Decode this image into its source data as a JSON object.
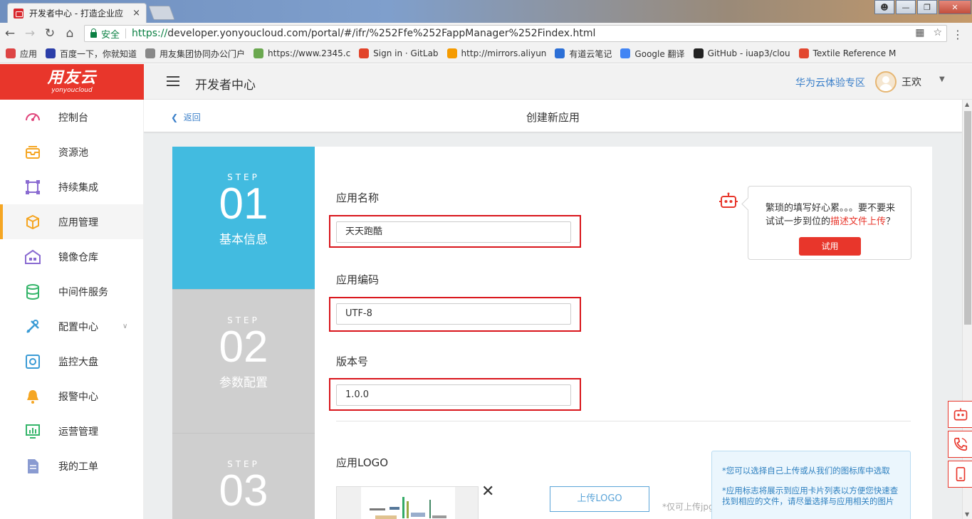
{
  "browser": {
    "tab_title": "开发者中心 - 打造企业应",
    "tab_close": "×",
    "secure_label": "安全",
    "url_scheme": "https://",
    "url_rest": "developer.yonyoucloud.com/portal/#/ifr/%252Ffe%252FappManager%252Findex.html",
    "bookmarks": [
      {
        "label": "应用",
        "color": "#d44"
      },
      {
        "label": "百度一下，你就知道",
        "color": "#2b3ea8"
      },
      {
        "label": "用友集团协同办公门户",
        "color": "#888"
      },
      {
        "label": "https://www.2345.c",
        "color": "#6aa84f"
      },
      {
        "label": "Sign in · GitLab",
        "color": "#e24329"
      },
      {
        "label": "http://mirrors.aliyun",
        "color": "#f59b00"
      },
      {
        "label": "有道云笔记",
        "color": "#2c6fd6"
      },
      {
        "label": "Google 翻译",
        "color": "#4285f4"
      },
      {
        "label": "GitHub - iuap3/clou",
        "color": "#222"
      },
      {
        "label": "Textile Reference M",
        "color": "#e2472f"
      }
    ]
  },
  "brand": {
    "cn": "用友云",
    "en": "yonyoucloud",
    "color": "#e8362b"
  },
  "header": {
    "title": "开发者中心",
    "link": "华为云体验专区",
    "username": "王欢"
  },
  "sidebar": {
    "items": [
      {
        "label": "控制台",
        "icon": "dashboard-icon",
        "color": "#e0457b"
      },
      {
        "label": "资源池",
        "icon": "resource-pool-icon",
        "color": "#f5a623"
      },
      {
        "label": "持续集成",
        "icon": "integration-icon",
        "color": "#8a6bd1"
      },
      {
        "label": "应用管理",
        "icon": "cube-icon",
        "color": "#f5a623"
      },
      {
        "label": "镜像仓库",
        "icon": "warehouse-icon",
        "color": "#8a6bd1"
      },
      {
        "label": "中间件服务",
        "icon": "database-icon",
        "color": "#35b56a"
      },
      {
        "label": "配置中心",
        "icon": "tools-icon",
        "color": "#3a9bd5"
      },
      {
        "label": "监控大盘",
        "icon": "monitor-icon",
        "color": "#3a9bd5"
      },
      {
        "label": "报警中心",
        "icon": "bell-icon",
        "color": "#f5a623"
      },
      {
        "label": "运营管理",
        "icon": "chart-icon",
        "color": "#35b56a"
      },
      {
        "label": "我的工单",
        "icon": "document-icon",
        "color": "#8a9bd1"
      }
    ]
  },
  "page": {
    "back_label": "返回",
    "title": "创建新应用"
  },
  "steps": [
    {
      "label": "STEP",
      "number": "01",
      "name": "基本信息"
    },
    {
      "label": "STEP",
      "number": "02",
      "name": "参数配置"
    },
    {
      "label": "STEP",
      "number": "03",
      "name": ""
    }
  ],
  "form": {
    "app_name_label": "应用名称",
    "app_name_value": "天天跑酷",
    "app_code_label": "应用编码",
    "app_code_value": "UTF-8",
    "version_label": "版本号",
    "version_value": "1.0.0",
    "logo_label": "应用LOGO",
    "upload_label": "上传LOGO",
    "upload_hint": "*仅可上传jpg",
    "close_preview": "✕"
  },
  "tip": {
    "line1": "繁琐的填写好心累。。。要不要来",
    "line2_prefix": "试试一步到位的",
    "line2_highlight": "描述文件上传",
    "line2_suffix": "？",
    "button": "试用"
  },
  "notes": [
    "*您可以选择自己上传或从我们的图标库中选取",
    "*应用标志将展示到应用卡片列表以方便您快速查找到相应的文件，请尽量选择与应用相关的图片"
  ]
}
